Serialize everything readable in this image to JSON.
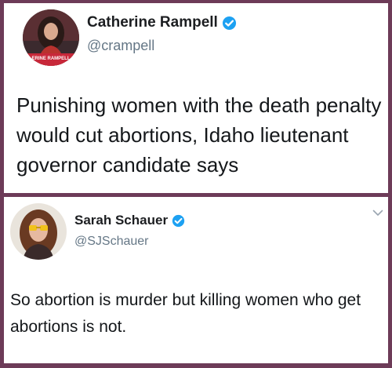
{
  "tweets": [
    {
      "display_name": "Catherine Rampell",
      "handle": "@crampell",
      "text": "Punishing women with the death penalty would cut abortions, Idaho lieutenant governor candidate says",
      "avatar_caption": "ERINE RAMPELL",
      "verified_icon": "verified-badge-icon"
    },
    {
      "display_name": "Sarah Schauer",
      "handle": "@SJSchauer",
      "text": "So abortion is murder but killing women who get abortions is not.",
      "verified_icon": "verified-badge-icon",
      "menu_icon": "chevron-down-icon"
    }
  ],
  "colors": {
    "background": "#6d3b58",
    "verified_blue": "#1da1f2",
    "handle_gray": "#657786"
  }
}
